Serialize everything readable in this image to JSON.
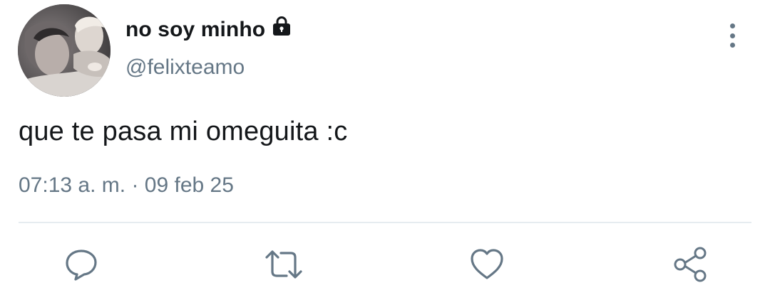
{
  "tweet": {
    "display_name": "no soy minho",
    "handle": "@felixteamo",
    "text": "que te pasa mi omeguita :c",
    "time": "07:13 a. m.",
    "separator": "·",
    "date": "09 feb 25"
  },
  "icons": {
    "avatar": "profile-photo",
    "protected": "lock-icon",
    "more": "more-vertical-icon",
    "reply": "reply-icon",
    "retweet": "retweet-icon",
    "like": "heart-icon",
    "share": "share-icon"
  },
  "colors": {
    "text": "#14171a",
    "secondary": "#657786",
    "divider": "#e6ecf0"
  }
}
